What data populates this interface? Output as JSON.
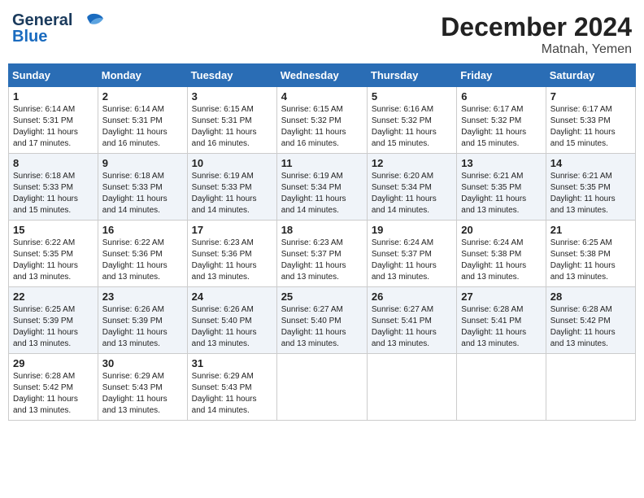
{
  "header": {
    "month": "December 2024",
    "location": "Matnah, Yemen",
    "logo_general": "General",
    "logo_blue": "Blue"
  },
  "days_of_week": [
    "Sunday",
    "Monday",
    "Tuesday",
    "Wednesday",
    "Thursday",
    "Friday",
    "Saturday"
  ],
  "weeks": [
    [
      {
        "day": "1",
        "info": "Sunrise: 6:14 AM\nSunset: 5:31 PM\nDaylight: 11 hours\nand 17 minutes."
      },
      {
        "day": "2",
        "info": "Sunrise: 6:14 AM\nSunset: 5:31 PM\nDaylight: 11 hours\nand 16 minutes."
      },
      {
        "day": "3",
        "info": "Sunrise: 6:15 AM\nSunset: 5:31 PM\nDaylight: 11 hours\nand 16 minutes."
      },
      {
        "day": "4",
        "info": "Sunrise: 6:15 AM\nSunset: 5:32 PM\nDaylight: 11 hours\nand 16 minutes."
      },
      {
        "day": "5",
        "info": "Sunrise: 6:16 AM\nSunset: 5:32 PM\nDaylight: 11 hours\nand 15 minutes."
      },
      {
        "day": "6",
        "info": "Sunrise: 6:17 AM\nSunset: 5:32 PM\nDaylight: 11 hours\nand 15 minutes."
      },
      {
        "day": "7",
        "info": "Sunrise: 6:17 AM\nSunset: 5:33 PM\nDaylight: 11 hours\nand 15 minutes."
      }
    ],
    [
      {
        "day": "8",
        "info": "Sunrise: 6:18 AM\nSunset: 5:33 PM\nDaylight: 11 hours\nand 15 minutes."
      },
      {
        "day": "9",
        "info": "Sunrise: 6:18 AM\nSunset: 5:33 PM\nDaylight: 11 hours\nand 14 minutes."
      },
      {
        "day": "10",
        "info": "Sunrise: 6:19 AM\nSunset: 5:33 PM\nDaylight: 11 hours\nand 14 minutes."
      },
      {
        "day": "11",
        "info": "Sunrise: 6:19 AM\nSunset: 5:34 PM\nDaylight: 11 hours\nand 14 minutes."
      },
      {
        "day": "12",
        "info": "Sunrise: 6:20 AM\nSunset: 5:34 PM\nDaylight: 11 hours\nand 14 minutes."
      },
      {
        "day": "13",
        "info": "Sunrise: 6:21 AM\nSunset: 5:35 PM\nDaylight: 11 hours\nand 13 minutes."
      },
      {
        "day": "14",
        "info": "Sunrise: 6:21 AM\nSunset: 5:35 PM\nDaylight: 11 hours\nand 13 minutes."
      }
    ],
    [
      {
        "day": "15",
        "info": "Sunrise: 6:22 AM\nSunset: 5:35 PM\nDaylight: 11 hours\nand 13 minutes."
      },
      {
        "day": "16",
        "info": "Sunrise: 6:22 AM\nSunset: 5:36 PM\nDaylight: 11 hours\nand 13 minutes."
      },
      {
        "day": "17",
        "info": "Sunrise: 6:23 AM\nSunset: 5:36 PM\nDaylight: 11 hours\nand 13 minutes."
      },
      {
        "day": "18",
        "info": "Sunrise: 6:23 AM\nSunset: 5:37 PM\nDaylight: 11 hours\nand 13 minutes."
      },
      {
        "day": "19",
        "info": "Sunrise: 6:24 AM\nSunset: 5:37 PM\nDaylight: 11 hours\nand 13 minutes."
      },
      {
        "day": "20",
        "info": "Sunrise: 6:24 AM\nSunset: 5:38 PM\nDaylight: 11 hours\nand 13 minutes."
      },
      {
        "day": "21",
        "info": "Sunrise: 6:25 AM\nSunset: 5:38 PM\nDaylight: 11 hours\nand 13 minutes."
      }
    ],
    [
      {
        "day": "22",
        "info": "Sunrise: 6:25 AM\nSunset: 5:39 PM\nDaylight: 11 hours\nand 13 minutes."
      },
      {
        "day": "23",
        "info": "Sunrise: 6:26 AM\nSunset: 5:39 PM\nDaylight: 11 hours\nand 13 minutes."
      },
      {
        "day": "24",
        "info": "Sunrise: 6:26 AM\nSunset: 5:40 PM\nDaylight: 11 hours\nand 13 minutes."
      },
      {
        "day": "25",
        "info": "Sunrise: 6:27 AM\nSunset: 5:40 PM\nDaylight: 11 hours\nand 13 minutes."
      },
      {
        "day": "26",
        "info": "Sunrise: 6:27 AM\nSunset: 5:41 PM\nDaylight: 11 hours\nand 13 minutes."
      },
      {
        "day": "27",
        "info": "Sunrise: 6:28 AM\nSunset: 5:41 PM\nDaylight: 11 hours\nand 13 minutes."
      },
      {
        "day": "28",
        "info": "Sunrise: 6:28 AM\nSunset: 5:42 PM\nDaylight: 11 hours\nand 13 minutes."
      }
    ],
    [
      {
        "day": "29",
        "info": "Sunrise: 6:28 AM\nSunset: 5:42 PM\nDaylight: 11 hours\nand 13 minutes."
      },
      {
        "day": "30",
        "info": "Sunrise: 6:29 AM\nSunset: 5:43 PM\nDaylight: 11 hours\nand 13 minutes."
      },
      {
        "day": "31",
        "info": "Sunrise: 6:29 AM\nSunset: 5:43 PM\nDaylight: 11 hours\nand 14 minutes."
      },
      {
        "day": "",
        "info": ""
      },
      {
        "day": "",
        "info": ""
      },
      {
        "day": "",
        "info": ""
      },
      {
        "day": "",
        "info": ""
      }
    ]
  ]
}
